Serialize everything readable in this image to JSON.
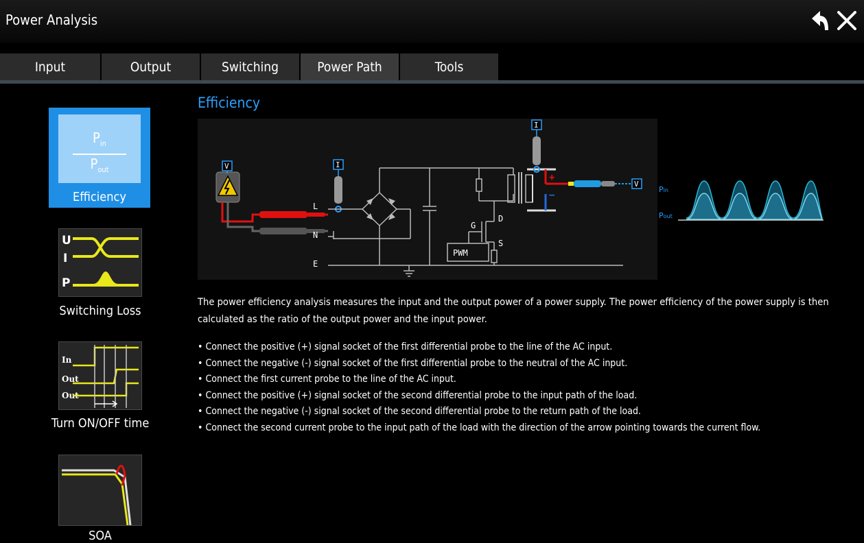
{
  "window": {
    "title": "Power Analysis"
  },
  "tabs": [
    {
      "label": "Input"
    },
    {
      "label": "Output"
    },
    {
      "label": "Switching"
    },
    {
      "label": "Power Path",
      "active": true
    },
    {
      "label": "Tools"
    }
  ],
  "sidebar": {
    "items": [
      {
        "label": "Efficiency",
        "selected": true,
        "numerator": "P",
        "numerator_sub": "in",
        "denominator": "P",
        "denominator_sub": "out"
      },
      {
        "label": "Switching Loss",
        "thumb_labels": [
          "U",
          "I",
          "P"
        ]
      },
      {
        "label": "Turn ON/OFF time",
        "thumb_labels": [
          "In",
          "Out",
          "Out"
        ]
      },
      {
        "label": "SOA"
      }
    ]
  },
  "content": {
    "title": "Efficiency",
    "schematic": {
      "probe_v": "V",
      "probe_i": "I",
      "node_l": "L",
      "node_n": "N",
      "node_e": "E",
      "gate": "G",
      "drain": "D",
      "source": "S",
      "pwm": "PWM",
      "plus": "+",
      "minus": "−"
    },
    "waveform": {
      "label_in": "P",
      "label_in_sub": "in",
      "label_out": "P",
      "label_out_sub": "out"
    },
    "description": "The power efficiency analysis measures the input and the output power of a power supply. The power efficiency of the power supply is then calculated as the ratio of the output power and the input power.",
    "bullets": [
      "Connect the positive (+) signal socket of the first differential probe to the line of the AC input.",
      "Connect the negative (-) signal socket of the first differential probe to the neutral of the AC input.",
      "Connect the first current probe to the line of the AC input.",
      "Connect the positive (+) signal socket of the second differential probe to the input path of the load.",
      "Connect the negative (-) signal socket of the second differential probe to the return path of the load.",
      "Connect the second current probe to the input path of the load with the direction of the arrow pointing towards the current flow."
    ]
  },
  "colors": {
    "accent": "#1f8fe6",
    "title_blue": "#2aa0ff",
    "trace_yellow": "#e8e81a",
    "probe_red": "#e01010",
    "probe_blue": "#1f9be0",
    "wave_fill": "#1c6e8a"
  },
  "icons": [
    "back-arrow-icon",
    "close-icon",
    "lightning-warning-icon",
    "ground-icon"
  ]
}
